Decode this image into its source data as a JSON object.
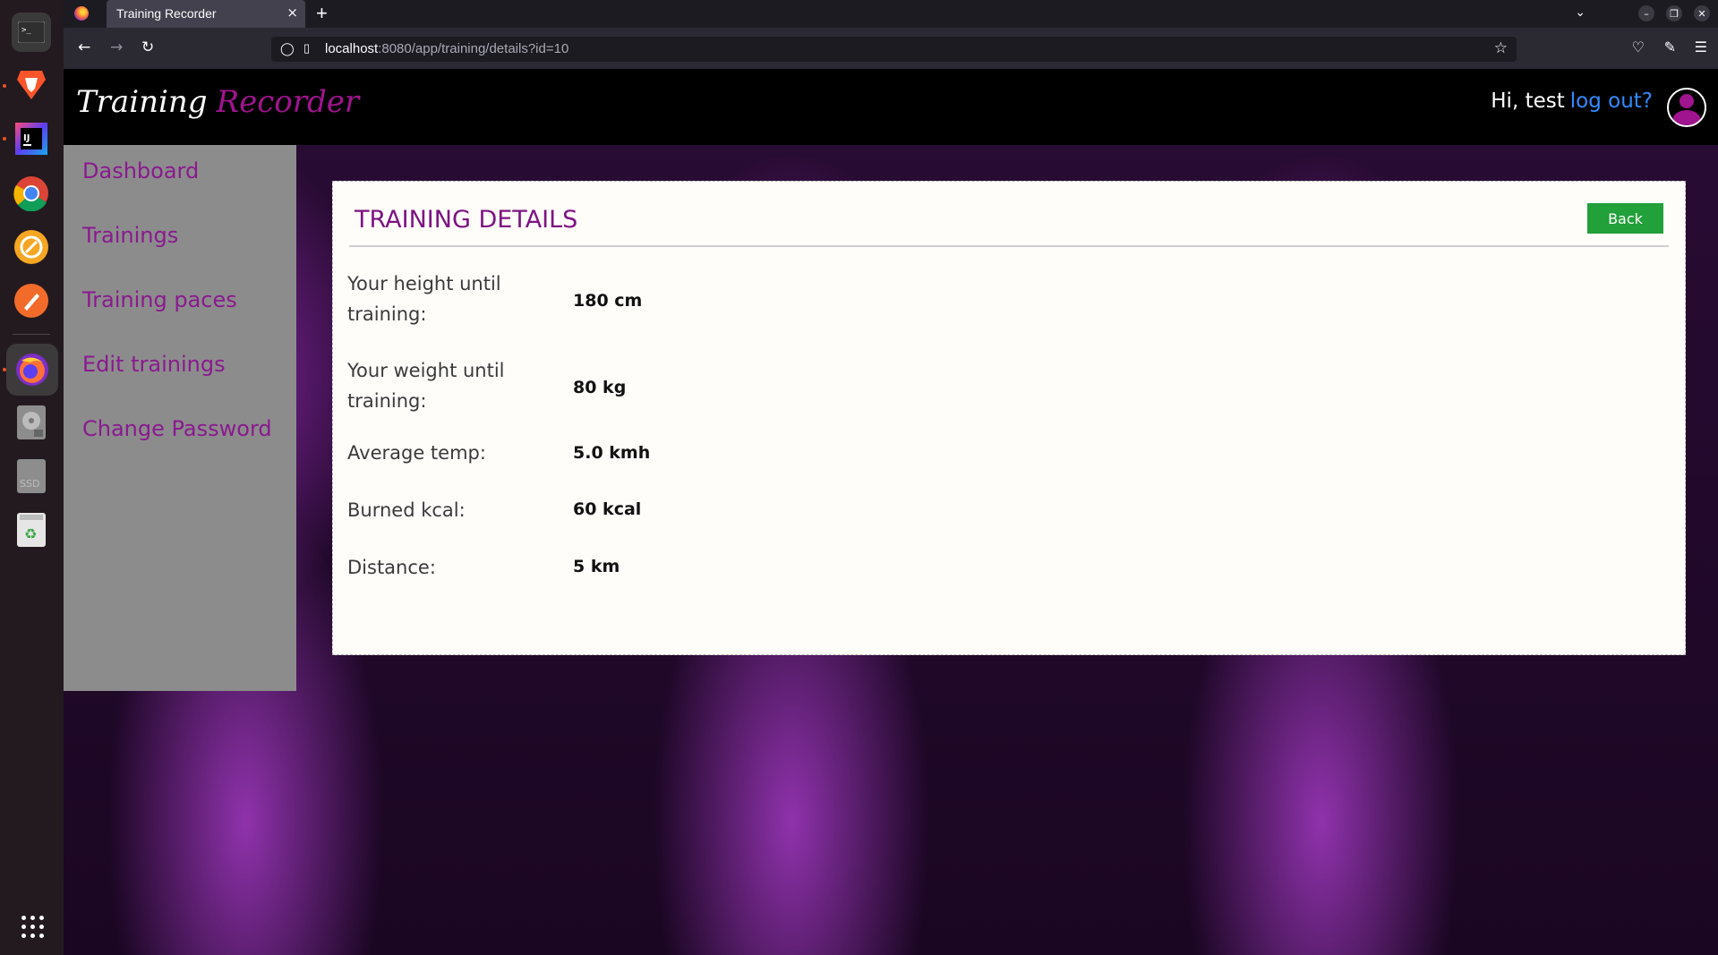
{
  "dock": {
    "items": [
      "terminal-icon",
      "brave-icon",
      "intellij-icon",
      "chrome-icon",
      "postman-icon",
      "pen-tool-icon",
      "firefox-icon",
      "disk-icon",
      "ssd-icon",
      "trash-icon"
    ],
    "apps_grid": "apps-grid-icon"
  },
  "browser": {
    "tab_title": "Training Recorder",
    "tab_close": "×",
    "new_tab": "+",
    "url_host": "localhost",
    "url_rest": ":8080/app/training/details?id=10"
  },
  "header": {
    "logo_part1": "Training",
    "logo_part2": "Recorder",
    "greeting": "Hi, test",
    "logout": "log out?"
  },
  "sidebar": {
    "items": [
      {
        "label": "Dashboard"
      },
      {
        "label": "Trainings"
      },
      {
        "label": "Training paces"
      },
      {
        "label": "Edit trainings"
      },
      {
        "label": "Change Password"
      }
    ]
  },
  "details": {
    "title": "TRAINING DETAILS",
    "back_label": "Back",
    "rows": [
      {
        "label": "Your height until training:",
        "value": "180 cm"
      },
      {
        "label": "Your weight until training:",
        "value": "80 kg"
      },
      {
        "label": "Average temp:",
        "value": "5.0 kmh"
      },
      {
        "label": "Burned kcal:",
        "value": "60 kcal"
      },
      {
        "label": "Distance:",
        "value": "5 km"
      }
    ]
  },
  "colors": {
    "accent": "#8a1a8f",
    "back_button": "#22a03a",
    "link": "#2f8bff"
  }
}
